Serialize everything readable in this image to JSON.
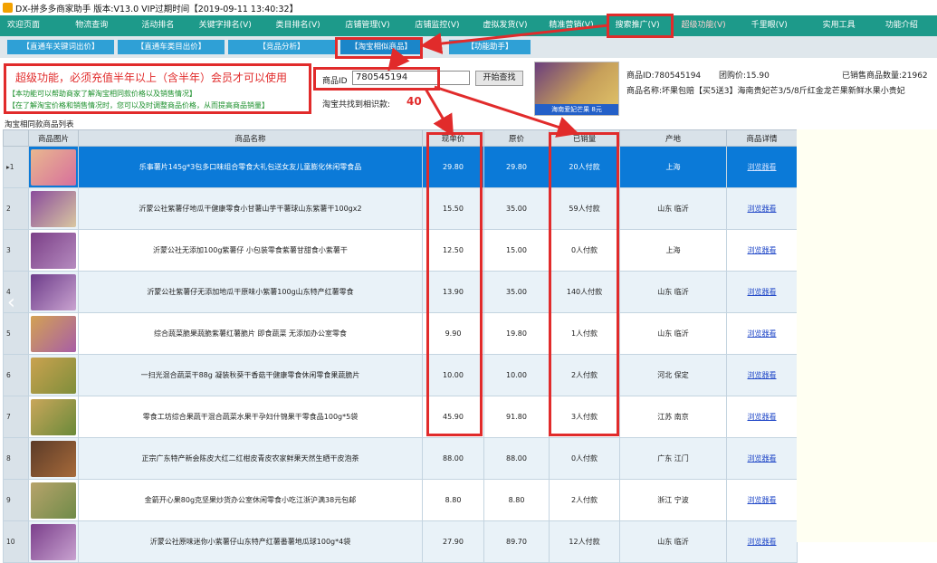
{
  "window": {
    "title": "DX-拼多多商家助手 版本:V13.0 VIP过期时间【2019-09-11 13:40:32】"
  },
  "menu": {
    "items": [
      {
        "label": "欢迎页面"
      },
      {
        "label": "物流查询"
      },
      {
        "label": "活动排名"
      },
      {
        "label": "关键字排名(V)"
      },
      {
        "label": "类目排名(V)"
      },
      {
        "label": "店铺管理(V)"
      },
      {
        "label": "店铺监控(V)"
      },
      {
        "label": "虚拟发货(V)"
      },
      {
        "label": "精准营销(V)"
      },
      {
        "label": "搜索推广(V)"
      },
      {
        "label": "超级功能(V)"
      },
      {
        "label": "千里眼(V)"
      },
      {
        "label": "实用工具"
      },
      {
        "label": "功能介绍"
      }
    ]
  },
  "subtabs": [
    {
      "label": "【直通车关键词出价】"
    },
    {
      "label": "【直通车类目出价】"
    },
    {
      "label": "【竞品分析】"
    },
    {
      "label": "【淘宝相似商品】"
    },
    {
      "label": "【功能助手】"
    }
  ],
  "notice": {
    "headline": "超级功能，必须充值半年以上（含半年）会员才可以使用",
    "line1": "【本功能可以帮助商家了解淘宝相同款价格以及销售情况】",
    "line2": "【在了解淘宝价格和销售情况时，您可以及时调整商品价格，从而提高商品销量】"
  },
  "search": {
    "id_label": "商品ID",
    "id_value": "780545194",
    "button_label": "开始查找",
    "found_label": "淘宝共找到相识款:",
    "found_count": "40"
  },
  "product": {
    "thumb_banner": "海南爱妃芒果 8元",
    "id_text": "商品ID:780545194",
    "group_price": "团购价:15.90",
    "sold_text": "已销售商品数量:21962",
    "name_text": "商品名称:坏果包赔【买5送3】海南贵妃芒3/5/8斤红金龙芒果新鲜水果小贵妃"
  },
  "table": {
    "caption": "淘宝相同款商品列表",
    "headers": [
      "",
      "商品图片",
      "商品名称",
      "现单价",
      "原价",
      "已销量",
      "产地",
      "商品详情"
    ],
    "rows": [
      {
        "num": "▸1",
        "name": "乐事薯片145g*3包多口味组合零食大礼包送女友儿童膨化休闲零食品",
        "price": "29.80",
        "orig": "29.80",
        "sales": "20人付款",
        "origin": "上海",
        "detail": "浏览器看",
        "c1": "#e8b78f",
        "c2": "#d86f9c"
      },
      {
        "num": "2",
        "name": "沂蒙公社紫薯仔地瓜干健康零食小甘薯山芋干薯球山东紫薯干100gx2",
        "price": "15.50",
        "orig": "35.00",
        "sales": "59人付款",
        "origin": "山东  临沂",
        "detail": "浏览器看",
        "c1": "#8a4c9c",
        "c2": "#d9c7a1"
      },
      {
        "num": "3",
        "name": "沂蒙公社无添加100g紫薯仔  小包装零食紫薯甘甜食小紫薯干",
        "price": "12.50",
        "orig": "15.00",
        "sales": "0人付款",
        "origin": "上海",
        "detail": "浏览器看",
        "c1": "#7b3f87",
        "c2": "#b58bbf"
      },
      {
        "num": "4",
        "name": "沂蒙公社紫薯仔无添加地瓜干原味小紫薯100g山东特产红薯零食",
        "price": "13.90",
        "orig": "35.00",
        "sales": "140人付款",
        "origin": "山东  临沂",
        "detail": "浏览器看",
        "c1": "#6d3c8a",
        "c2": "#c9a3d0"
      },
      {
        "num": "5",
        "name": "综合蔬菜脆果蔬脆紫薯红薯脆片  即食蔬菜  无添加办公室零食",
        "price": "9.90",
        "orig": "19.80",
        "sales": "1人付款",
        "origin": "山东  临沂",
        "detail": "浏览器看",
        "c1": "#d3a253",
        "c2": "#a85ea6"
      },
      {
        "num": "6",
        "name": "一扫光混合蔬菜干88g  凝装秋葵干香菇干健康零食休闲零食果蔬脆片",
        "price": "10.00",
        "orig": "10.00",
        "sales": "2人付款",
        "origin": "河北  保定",
        "detail": "浏览器看",
        "c1": "#caa24f",
        "c2": "#7f8e3b"
      },
      {
        "num": "7",
        "name": "零食工坊综合果蔬干混合蔬菜水果干孕妇什锦果干零食品100g*5袋",
        "price": "45.90",
        "orig": "91.80",
        "sales": "3人付款",
        "origin": "江苏  南京",
        "detail": "浏览器看",
        "c1": "#c9a65a",
        "c2": "#6a8a3a"
      },
      {
        "num": "8",
        "name": "正宗广东特产新会陈皮大红二红柑皮青皮农家鲜果天然生晒干皮泡茶",
        "price": "88.00",
        "orig": "88.00",
        "sales": "0人付款",
        "origin": "广东  江门",
        "detail": "浏览器看",
        "c1": "#5c3b28",
        "c2": "#a66a3a"
      },
      {
        "num": "9",
        "name": "金箭开心果80g克坚果炒货办公室休闲零食小吃江浙沪满38元包邮",
        "price": "8.80",
        "orig": "8.80",
        "sales": "2人付款",
        "origin": "浙江  宁波",
        "detail": "浏览器看",
        "c1": "#b7a36b",
        "c2": "#6f8b48"
      },
      {
        "num": "10",
        "name": "沂蒙公社原味迷你小紫薯仔山东特产红薯番薯地瓜球100g*4袋",
        "price": "27.90",
        "orig": "89.70",
        "sales": "12人付款",
        "origin": "山东  临沂",
        "detail": "浏览器看",
        "c1": "#7b3f8b",
        "c2": "#c8a2d0"
      }
    ]
  },
  "colors": {
    "menubar": "#1d9a8a",
    "subtab": "#2fa0d6",
    "selected_row": "#0b7ad8",
    "highlight": "#e12b2b"
  }
}
